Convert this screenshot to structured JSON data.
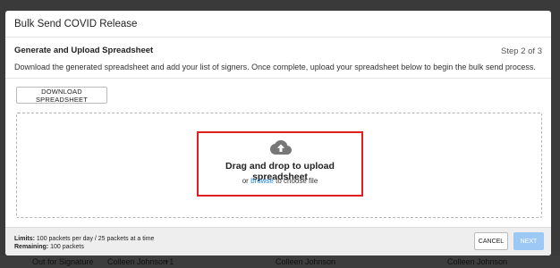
{
  "modal": {
    "title": "Bulk Send COVID Release"
  },
  "step": {
    "heading": "Generate and Upload Spreadsheet",
    "counter": "Step 2 of 3",
    "description": "Download the generated spreadsheet and add your list of signers. Once complete, upload your spreadsheet below to begin the bulk send process."
  },
  "download": {
    "label": "DOWNLOAD SPREADSHEET"
  },
  "dropzone": {
    "title": "Drag and drop to upload spreadsheet",
    "prefix": "or",
    "browse_label": "browse",
    "suffix": "to choose file",
    "icon": "cloud-upload-icon"
  },
  "footer": {
    "limits_label": "Limits:",
    "limits_value": "100 packets per day / 25 packets at a time",
    "remaining_label": "Remaining:",
    "remaining_value": "100 packets",
    "cancel_label": "CANCEL",
    "next_label": "NEXT"
  },
  "background": {
    "status_text": "Out for Signature",
    "name_1": "Colleen Johnson",
    "badge": "+1",
    "name_2": "Colleen Johnson",
    "name_3": "Colleen Johnson"
  },
  "colors": {
    "accent": "#1e88e5",
    "highlight": "#e02020",
    "next_disabled": "#9cc8f5"
  }
}
